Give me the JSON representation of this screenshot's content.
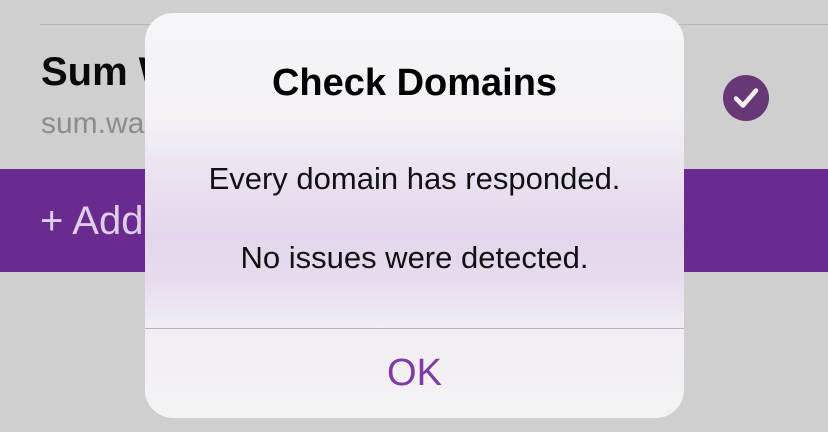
{
  "list": {
    "row": {
      "title": "Sum W",
      "subtitle": "sum.wa",
      "status_icon": "checkmark-circle-icon"
    },
    "add_label": "+ Add"
  },
  "alert": {
    "title": "Check Domains",
    "message_line1": "Every domain has responded.",
    "message_line2": "No issues were detected.",
    "ok_label": "OK"
  },
  "colors": {
    "accent": "#6b2a8f",
    "ok_text": "#7f3aa8",
    "check_fill": "#673876"
  }
}
